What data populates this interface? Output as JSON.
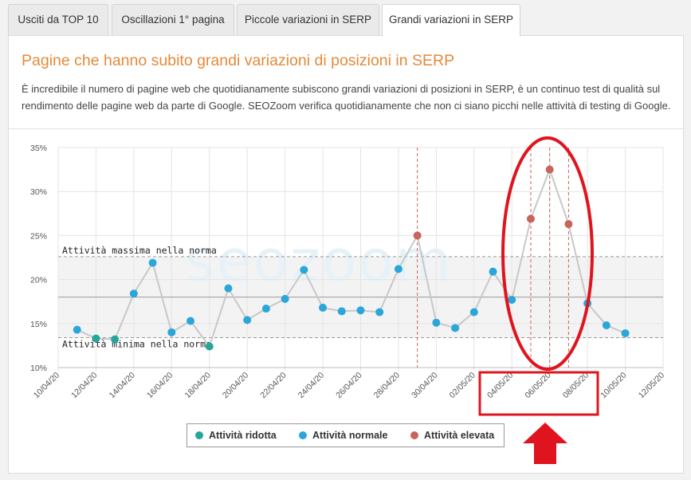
{
  "tabs": [
    {
      "label": "Usciti da TOP 10",
      "active": false
    },
    {
      "label": "Oscillazioni 1° pagina",
      "active": false
    },
    {
      "label": "Piccole variazioni in SERP",
      "active": false
    },
    {
      "label": "Grandi variazioni in SERP",
      "active": true
    }
  ],
  "panel": {
    "title": "Pagine che hanno subito grandi variazioni di posizioni in SERP",
    "description": "È incredibile il numero di pagine web che quotidianamente subiscono grandi variazioni di posizioni in SERP, è un continuo test di qualità sul rendimento delle pagine web da parte di Google. SEOZoom verifica quotidianamente che non ci siano picchi nelle attività di testing di Google."
  },
  "watermark": "seozoom",
  "colors": {
    "ridotta": "#26a69a",
    "normale": "#2aa7d8",
    "elevata": "#c9645a",
    "line": "#c8c8c8",
    "band": "#f3f3f3",
    "highlight": "#e0141e",
    "title": "#e48a3a"
  },
  "chart_data": {
    "type": "line",
    "y_tick_labels": [
      "10%",
      "15%",
      "20%",
      "25%",
      "30%",
      "35%"
    ],
    "ylim": [
      10,
      35
    ],
    "x_tick_labels": [
      "10/04/20",
      "12/04/20",
      "14/04/20",
      "16/04/20",
      "18/04/20",
      "20/04/20",
      "22/04/20",
      "24/04/20",
      "26/04/20",
      "28/04/20",
      "30/04/20",
      "02/05/20",
      "04/05/20",
      "06/05/20",
      "08/05/20",
      "10/05/20",
      "12/05/20"
    ],
    "x_start": "10/04/20",
    "grid": true,
    "band": {
      "max": 22.6,
      "min": 13.4,
      "mean": 18.0
    },
    "band_labels": {
      "max": "Attività massima nella norma",
      "min": "Attività minima nella norma"
    },
    "points": [
      {
        "date": "11/04/20",
        "value": 14.3,
        "category": "normale"
      },
      {
        "date": "12/04/20",
        "value": 13.3,
        "category": "ridotta"
      },
      {
        "date": "13/04/20",
        "value": 13.2,
        "category": "ridotta"
      },
      {
        "date": "14/04/20",
        "value": 18.4,
        "category": "normale"
      },
      {
        "date": "15/04/20",
        "value": 21.9,
        "category": "normale"
      },
      {
        "date": "16/04/20",
        "value": 14.0,
        "category": "normale"
      },
      {
        "date": "17/04/20",
        "value": 15.3,
        "category": "normale"
      },
      {
        "date": "18/04/20",
        "value": 12.4,
        "category": "ridotta"
      },
      {
        "date": "19/04/20",
        "value": 19.0,
        "category": "normale"
      },
      {
        "date": "20/04/20",
        "value": 15.4,
        "category": "normale"
      },
      {
        "date": "21/04/20",
        "value": 16.7,
        "category": "normale"
      },
      {
        "date": "22/04/20",
        "value": 17.8,
        "category": "normale"
      },
      {
        "date": "23/04/20",
        "value": 21.1,
        "category": "normale"
      },
      {
        "date": "24/04/20",
        "value": 16.8,
        "category": "normale"
      },
      {
        "date": "25/04/20",
        "value": 16.4,
        "category": "normale"
      },
      {
        "date": "26/04/20",
        "value": 16.5,
        "category": "normale"
      },
      {
        "date": "27/04/20",
        "value": 16.3,
        "category": "normale"
      },
      {
        "date": "28/04/20",
        "value": 21.2,
        "category": "normale"
      },
      {
        "date": "29/04/20",
        "value": 25.0,
        "category": "elevata"
      },
      {
        "date": "30/04/20",
        "value": 15.1,
        "category": "normale"
      },
      {
        "date": "01/05/20",
        "value": 14.5,
        "category": "normale"
      },
      {
        "date": "02/05/20",
        "value": 16.3,
        "category": "normale"
      },
      {
        "date": "03/05/20",
        "value": 20.9,
        "category": "normale"
      },
      {
        "date": "04/05/20",
        "value": 17.7,
        "category": "normale"
      },
      {
        "date": "05/05/20",
        "value": 26.9,
        "category": "elevata"
      },
      {
        "date": "06/05/20",
        "value": 32.5,
        "category": "elevata"
      },
      {
        "date": "07/05/20",
        "value": 26.3,
        "category": "elevata"
      },
      {
        "date": "08/05/20",
        "value": 17.3,
        "category": "normale"
      },
      {
        "date": "09/05/20",
        "value": 14.8,
        "category": "normale"
      },
      {
        "date": "10/05/20",
        "value": 13.9,
        "category": "normale"
      }
    ],
    "legend": [
      {
        "key": "ridotta",
        "label": "Attività ridotta"
      },
      {
        "key": "normale",
        "label": "Attività normale"
      },
      {
        "key": "elevata",
        "label": "Attività elevata"
      }
    ]
  }
}
